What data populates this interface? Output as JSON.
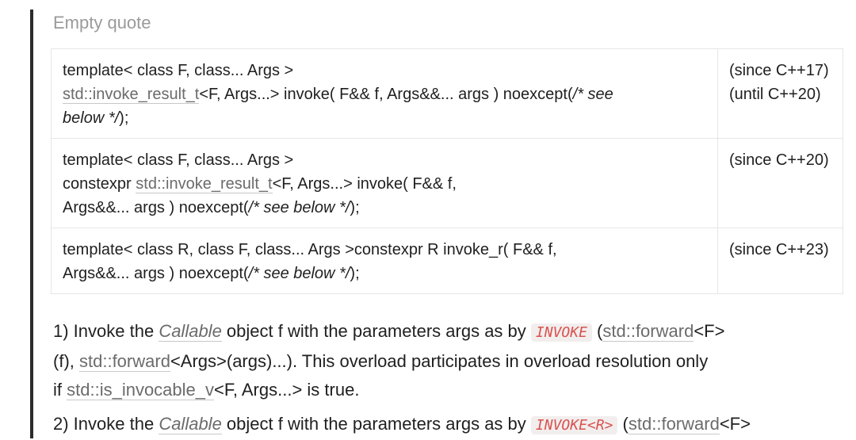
{
  "quote": {
    "placeholder": "Empty quote"
  },
  "table": {
    "rows": [
      {
        "line1": "template< class F, class... Args >",
        "l2_link": "std::invoke_result_t",
        "l2_rest": "<F, Args...>    invoke( F&& f, Args&&... args ) noexcept(",
        "l2_comment": "/* see",
        "l3_comment": "below */",
        "l3_tail": ");",
        "version": "(since C++17)\n(until C++20)"
      },
      {
        "line1": "template< class F, class... Args >",
        "l2_prefix": "constexpr ",
        "l2_link": "std::invoke_result_t",
        "l2_rest": "<F, Args...>    invoke( F&& f,",
        "l3_text": "Args&&... args ) noexcept(",
        "l3_comment": "/* see below */",
        "l3_tail": ");",
        "version": "(since C++20)"
      },
      {
        "line1": "template< class R, class F, class... Args >constexpr R invoke_r( F&& f,",
        "l2_text": "Args&&... args ) noexcept(",
        "l2_comment": "/* see below */",
        "l2_tail": ");",
        "version": "(since C++23)"
      }
    ]
  },
  "desc": {
    "p1": {
      "a": "1) Invoke the ",
      "callable": "Callable",
      "b": " object f with the parameters args as by ",
      "code": "INVOKE",
      "c": " (",
      "fwd1": "std::forward",
      "d": "<F>",
      "e": "(f), ",
      "fwd2": "std::forward",
      "f": "<Args>(args)...). This overload participates in overload resolution only",
      "g": "if ",
      "isinv": "std::is_invocable_v",
      "h": "<F, Args...> is true."
    },
    "p2": {
      "a": "2) Invoke the ",
      "callable": "Callable",
      "b": " object f with the parameters args as by ",
      "code": "INVOKE<R>",
      "c": " (",
      "fwd1": "std::forward",
      "d": "<F>"
    }
  }
}
